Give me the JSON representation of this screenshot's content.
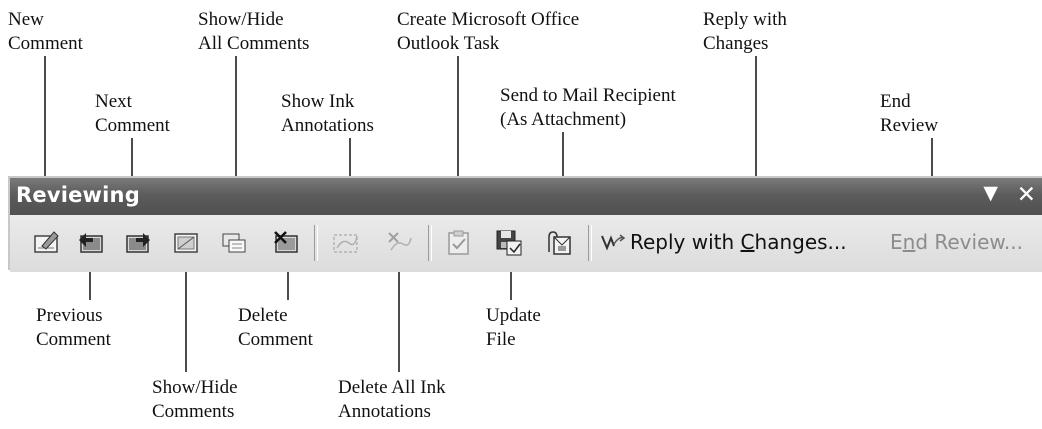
{
  "toolbar": {
    "title": "Reviewing",
    "dropdown_glyph": "▼",
    "close_glyph": "✕",
    "reply_with_changes": {
      "pre": "Reply with ",
      "key": "C",
      "post": "hanges..."
    },
    "end_review": {
      "pre": "E",
      "key": "n",
      "post": "d Review..."
    }
  },
  "icons": [
    "new-comment-icon",
    "previous-comment-icon",
    "next-comment-icon",
    "show-hide-comments-icon",
    "show-hide-all-comments-icon",
    "delete-comment-icon",
    "show-ink-annotations-icon",
    "delete-all-ink-annotations-icon",
    "create-outlook-task-icon",
    "update-file-icon",
    "send-to-mail-recipient-icon",
    "reply-with-changes-icon"
  ],
  "callouts": {
    "new_comment": [
      "New",
      "Comment"
    ],
    "next_comment": [
      "Next",
      "Comment"
    ],
    "show_hide_all_comments": [
      "Show/Hide",
      "All Comments"
    ],
    "show_ink_annotations": [
      "Show Ink",
      "Annotations"
    ],
    "create_outlook_task": [
      "Create Microsoft Office",
      "Outlook Task"
    ],
    "send_to_mail_recipient": [
      "Send to Mail Recipient",
      "(As Attachment)"
    ],
    "reply_with_changes": [
      "Reply with",
      "Changes"
    ],
    "end_review": [
      "End",
      "Review"
    ],
    "previous_comment": [
      "Previous",
      "Comment"
    ],
    "delete_comment": [
      "Delete",
      "Comment"
    ],
    "update_file": [
      "Update",
      "File"
    ],
    "show_hide_comments": [
      "Show/Hide",
      "Comments"
    ],
    "delete_all_ink_annotations": [
      "Delete All Ink",
      "Annotations"
    ]
  }
}
